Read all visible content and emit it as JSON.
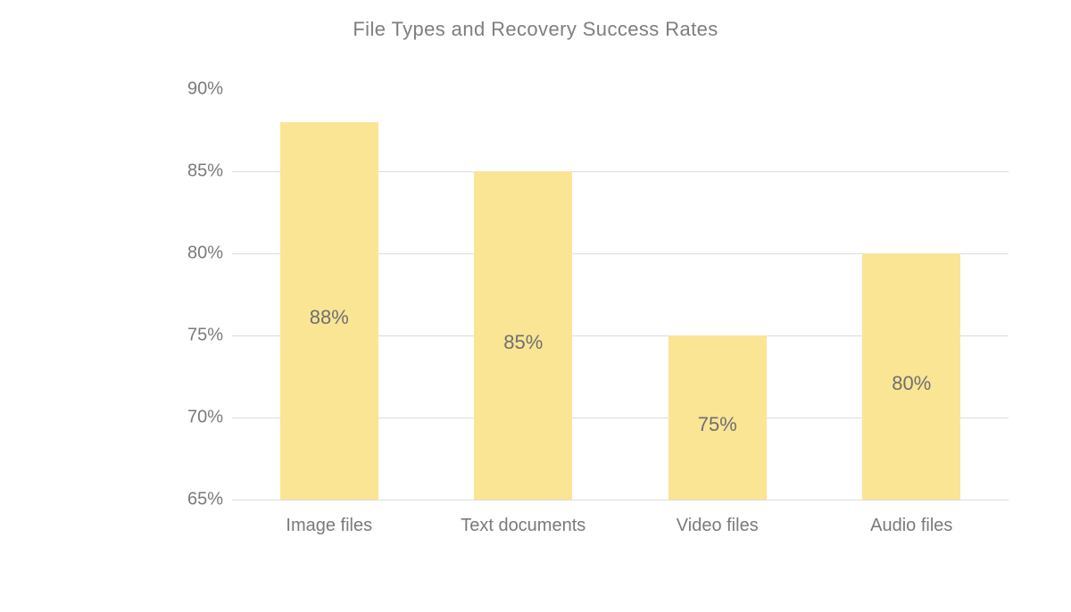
{
  "chart_data": {
    "type": "bar",
    "title": "File Types and Recovery Success Rates",
    "categories": [
      "Image files",
      "Text documents",
      "Video files",
      "Audio files"
    ],
    "values": [
      88,
      85,
      75,
      80
    ],
    "value_labels": [
      "88%",
      "85%",
      "75%",
      "80%"
    ],
    "y_ticks": [
      65,
      70,
      75,
      80,
      85,
      90
    ],
    "y_tick_labels": [
      "65%",
      "70%",
      "75%",
      "80%",
      "85%",
      "90%"
    ],
    "ylim": [
      65,
      90
    ],
    "xlabel": "",
    "ylabel": "",
    "bar_color": "#fae595"
  }
}
